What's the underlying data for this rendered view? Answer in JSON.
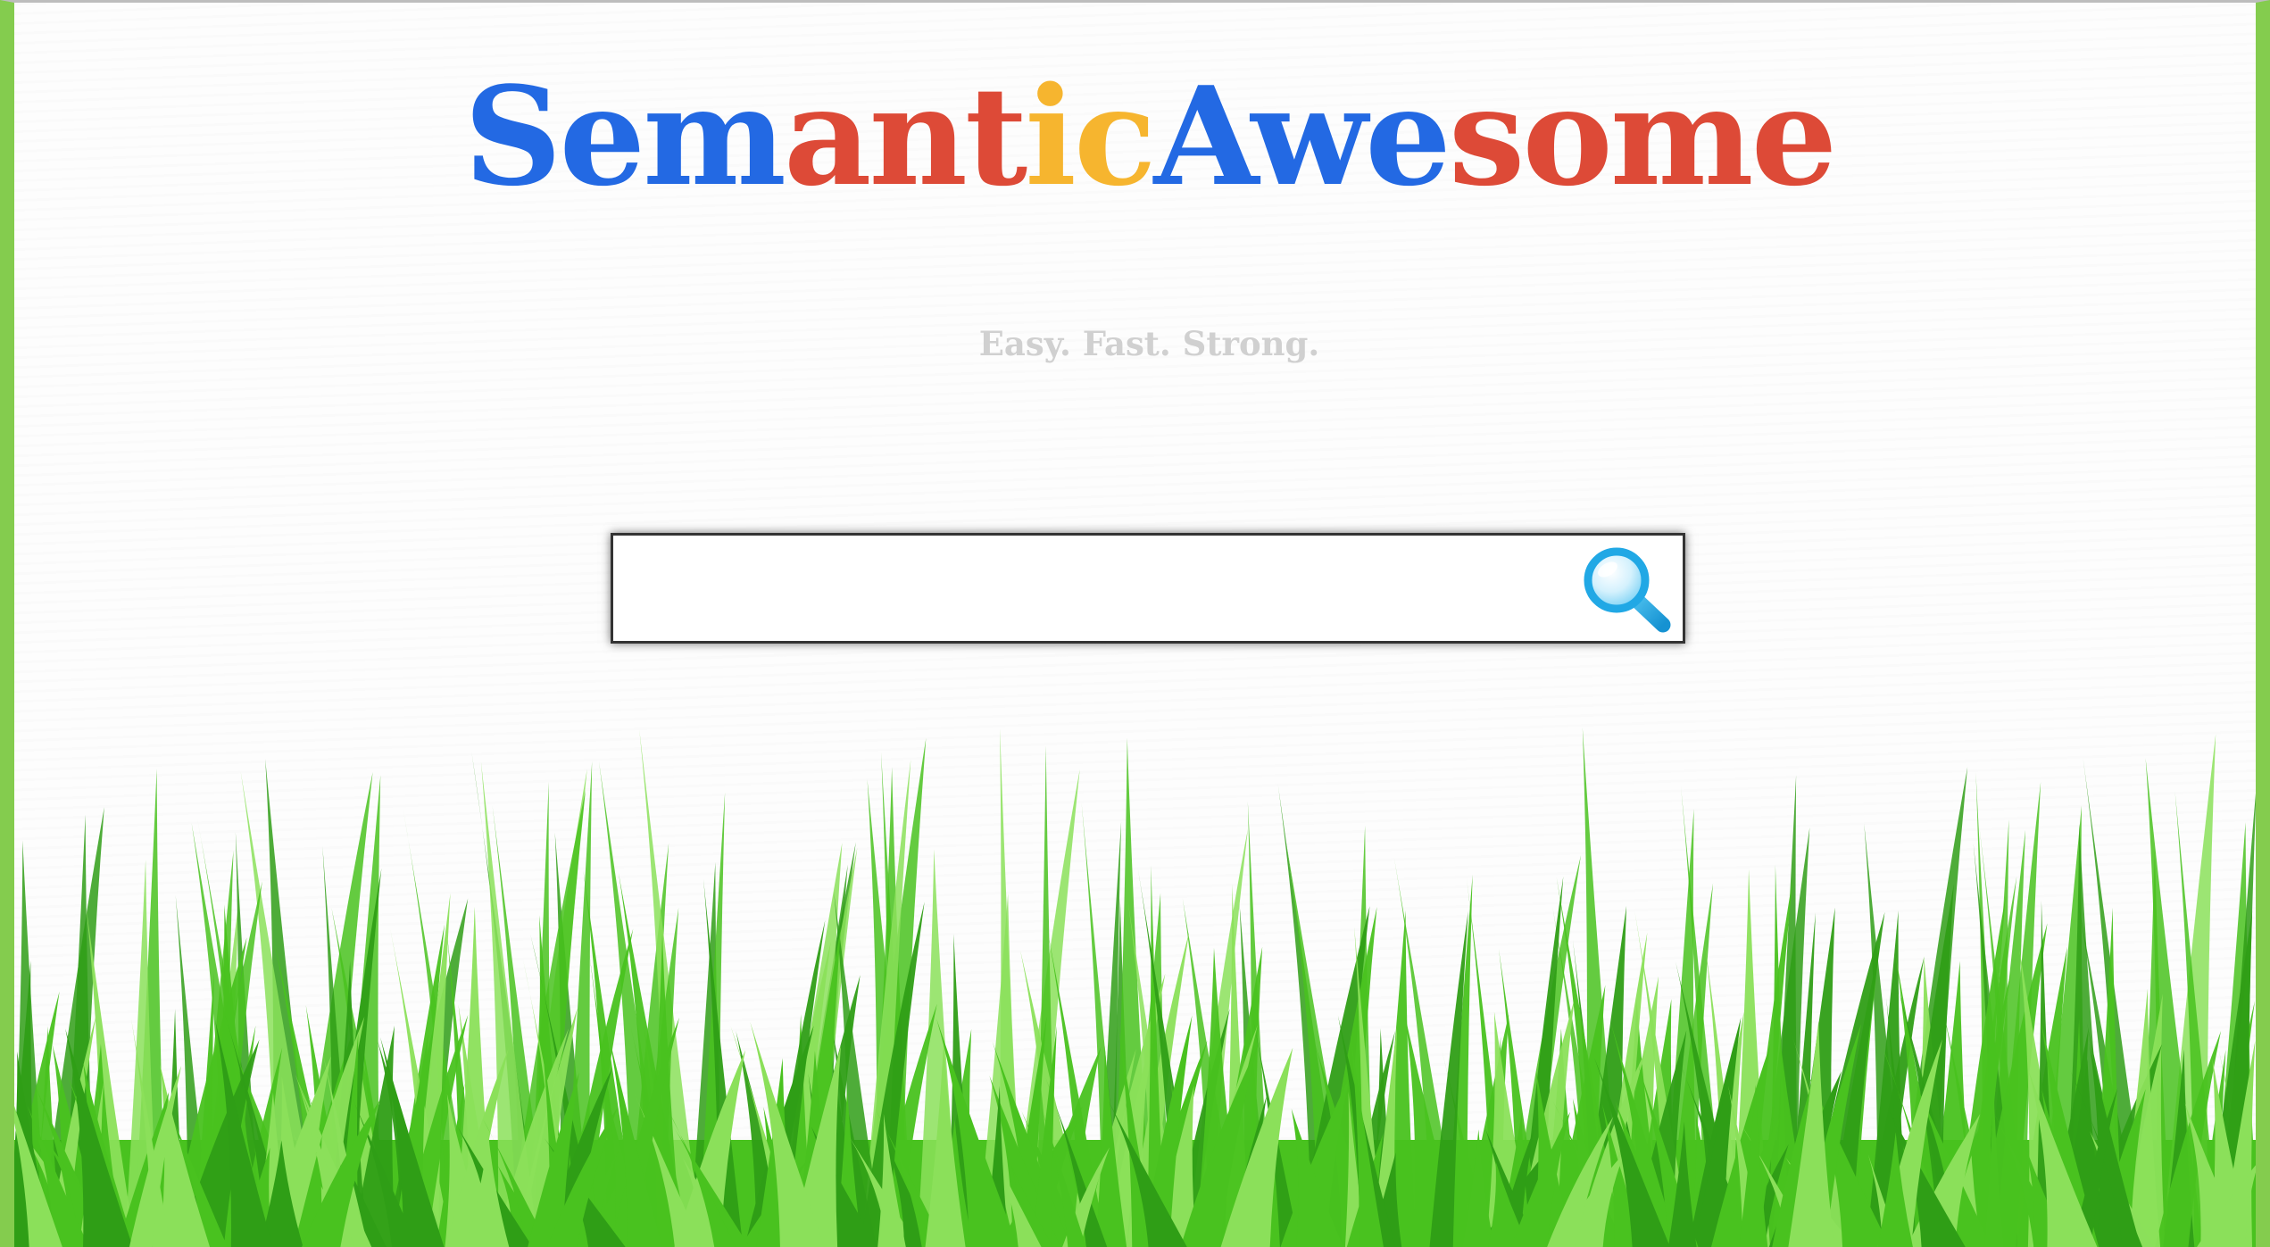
{
  "logo": {
    "letters": [
      {
        "text": "Sem",
        "color": "#2369e3"
      },
      {
        "text": "ant",
        "color": "#dd4a37"
      },
      {
        "text": "ic",
        "color": "#f6b52f"
      },
      {
        "text": "Awe",
        "color": "#2369e3"
      },
      {
        "text": "some",
        "color": "#dd4a37"
      }
    ]
  },
  "tagline": "Easy. Fast. Strong.",
  "search": {
    "value": "",
    "placeholder": "",
    "button_icon": "magnifier-icon"
  },
  "colors": {
    "frame_border": "#84cc4e",
    "grass_dark": "#2f9e16",
    "grass_mid": "#49c21f",
    "grass_light": "#8be05a",
    "search_icon": "#21a8e5"
  }
}
